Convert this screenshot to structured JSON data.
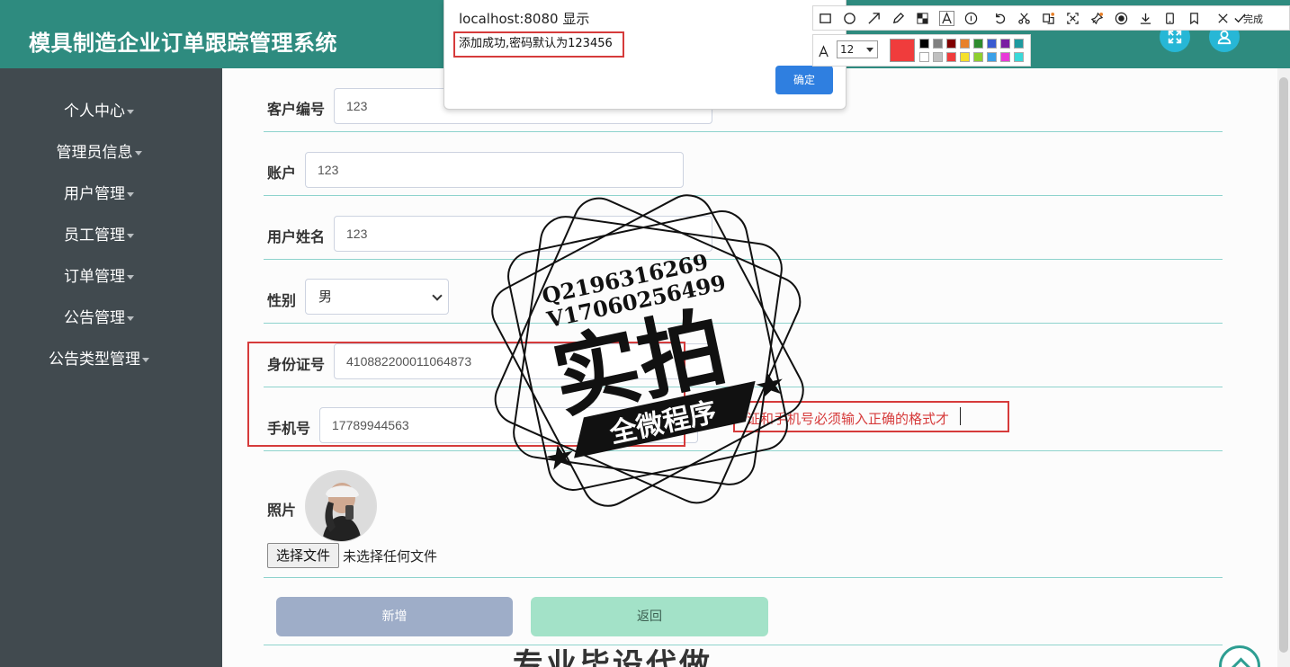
{
  "header": {
    "title": "模具制造企业订单跟踪管理系统"
  },
  "sidebar": {
    "items": [
      {
        "label": "个人中心"
      },
      {
        "label": "管理员信息"
      },
      {
        "label": "用户管理"
      },
      {
        "label": "员工管理"
      },
      {
        "label": "订单管理"
      },
      {
        "label": "公告管理"
      },
      {
        "label": "公告类型管理"
      }
    ]
  },
  "form": {
    "customer_no": {
      "label": "客户编号",
      "value": "123"
    },
    "account": {
      "label": "账户",
      "value": "123"
    },
    "user_name": {
      "label": "用户姓名",
      "value": "123"
    },
    "gender": {
      "label": "性别",
      "value": "男"
    },
    "id_card": {
      "label": "身份证号",
      "value": "410882200011064873"
    },
    "phone": {
      "label": "手机号",
      "value": "17789944563"
    },
    "photo": {
      "label": "照片",
      "choose_file": "选择文件",
      "no_file": "未选择任何文件"
    },
    "hint": "证和手机号必须输入正确的格式才",
    "add_button": "新增",
    "back_button": "返回"
  },
  "dialog": {
    "title": "localhost:8080 显示",
    "message": "添加成功,密码默认为123456",
    "ok": "确定"
  },
  "toolbar": {
    "done": "完成",
    "font_size": "12",
    "current_color": "#f03c3c",
    "swatches_top": [
      "#000000",
      "#808080",
      "#800000",
      "#e8812b",
      "#2e8b2e",
      "#3a5bd0",
      "#7a1fa2",
      "#1e9aa0"
    ],
    "swatches_bottom": [
      "#ffffff",
      "#c0c0c0",
      "#f03c3c",
      "#f5e02a",
      "#8fcf2f",
      "#3aa0e8",
      "#e83ad8",
      "#39d9d9"
    ]
  },
  "watermark": {
    "line1": "Q2196316269",
    "line2": "V17060256499",
    "main": "实拍",
    "ribbon": "全微程序",
    "bottom": "专业毕设代做"
  }
}
